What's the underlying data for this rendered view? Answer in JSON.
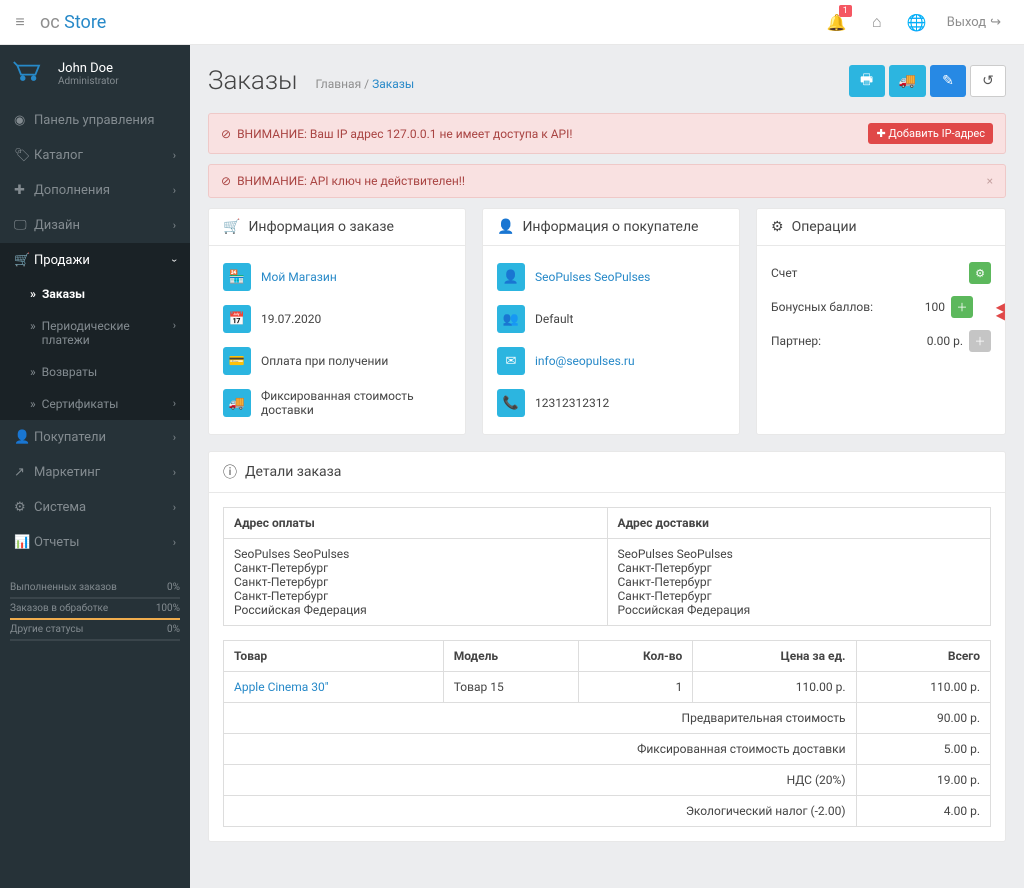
{
  "header": {
    "logo_prefix": "oc",
    "logo_main": "Store",
    "notifications_count": "1",
    "logout_label": "Выход"
  },
  "user": {
    "name": "John Doe",
    "role": "Administrator"
  },
  "sidebar": {
    "dashboard": "Панель управления",
    "catalog": "Каталог",
    "extensions": "Дополнения",
    "design": "Дизайн",
    "sales": "Продажи",
    "sales_sub": {
      "orders": "Заказы",
      "recurring": "Периодические платежи",
      "returns": "Возвраты",
      "vouchers": "Сертификаты"
    },
    "customers": "Покупатели",
    "marketing": "Маркетинг",
    "system": "Система",
    "reports": "Отчеты"
  },
  "stats": {
    "row1_label": "Выполненных заказов",
    "row1_val": "0%",
    "row2_label": "Заказов в обработке",
    "row2_val": "100%",
    "row3_label": "Другие статусы",
    "row3_val": "0%"
  },
  "page": {
    "title": "Заказы",
    "breadcrumb_home": "Главная",
    "breadcrumb_current": "Заказы"
  },
  "alerts": {
    "ip_warning": "ВНИМАНИЕ: Ваш IP адрес 127.0.0.1 не имеет доступа к API!",
    "ip_button": "Добавить IP-адрес",
    "api_warning": "ВНИМАНИЕ: API ключ не действителен!!"
  },
  "order_info": {
    "title": "Информация о заказе",
    "store": "Мой Магазин",
    "date": "19.07.2020",
    "payment": "Оплата при получении",
    "shipping": "Фиксированная стоимость доставки"
  },
  "customer_info": {
    "title": "Информация о покупателе",
    "name": "SeoPulses SeoPulses",
    "group": "Default",
    "email": "info@seopulses.ru",
    "phone": "12312312312"
  },
  "operations": {
    "title": "Операции",
    "invoice_label": "Счет",
    "points_label": "Бонусных баллов:",
    "points_value": "100",
    "affiliate_label": "Партнер:",
    "affiliate_value": "0.00 р."
  },
  "details": {
    "title": "Детали заказа",
    "payment_address_header": "Адрес оплаты",
    "shipping_address_header": "Адрес доставки",
    "payment_address": "SeoPulses SeoPulses\nСанкт-Петербург\nСанкт-Петербург\nСанкт-Петербург\nРоссийская Федерация",
    "shipping_address": "SeoPulses SeoPulses\nСанкт-Петербург\nСанкт-Петербург\nСанкт-Петербург\nРоссийская Федерация",
    "columns": {
      "product": "Товар",
      "model": "Модель",
      "quantity": "Кол-во",
      "price": "Цена за ед.",
      "total": "Всего"
    },
    "product": {
      "name": "Apple Cinema 30\"",
      "model": "Товар 15",
      "quantity": "1",
      "price": "110.00 р.",
      "total": "110.00 р."
    },
    "totals": {
      "subtotal_label": "Предварительная стоимость",
      "subtotal_value": "90.00 р.",
      "shipping_label": "Фиксированная стоимость доставки",
      "shipping_value": "5.00 р.",
      "vat_label": "НДС (20%)",
      "vat_value": "19.00 р.",
      "eco_label": "Экологический налог (-2.00)",
      "eco_value": "4.00 р."
    }
  }
}
